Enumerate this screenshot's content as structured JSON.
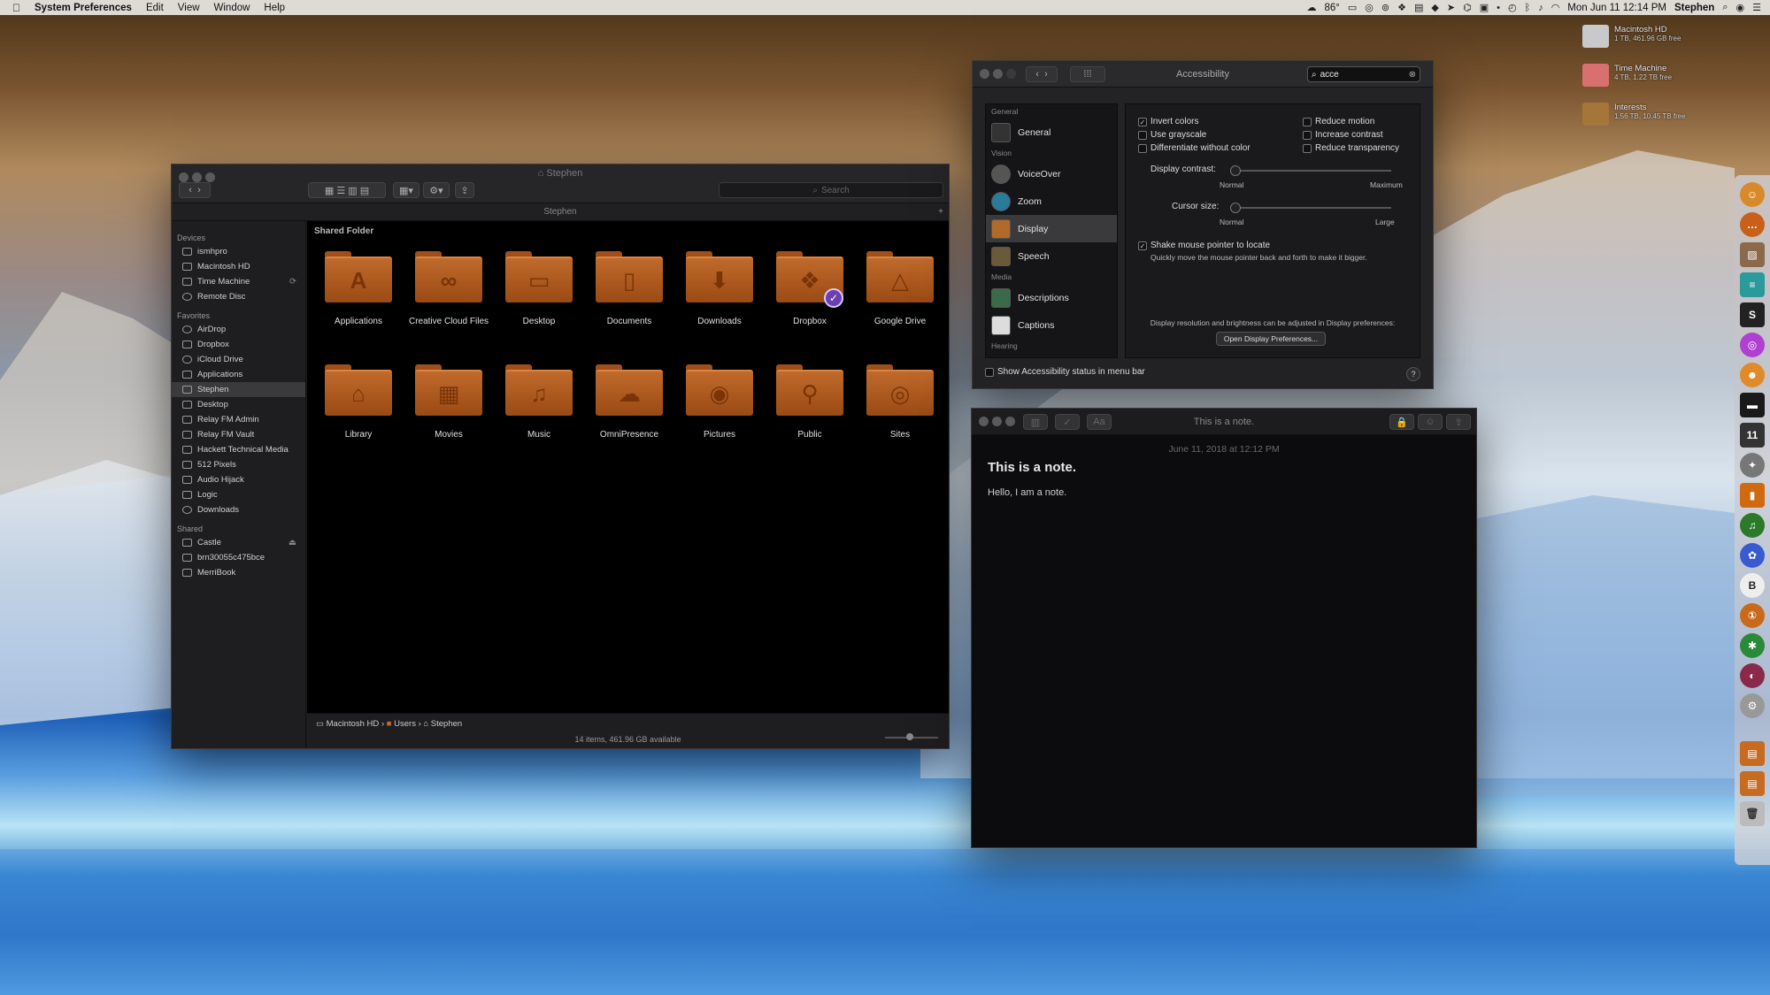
{
  "menubar": {
    "app": "System Preferences",
    "items": [
      "Edit",
      "View",
      "Window",
      "Help"
    ],
    "weather": "86°",
    "datetime": "Mon Jun 11  12:14 PM",
    "user": "Stephen"
  },
  "desktop": {
    "drives": [
      {
        "name": "Macintosh HD",
        "sub": "1 TB, 461.96 GB free"
      },
      {
        "name": "Time Machine",
        "sub": "4 TB, 1.22 TB free"
      },
      {
        "name": "Interests",
        "sub": "1.56 TB, 10.45 TB free"
      }
    ]
  },
  "finder": {
    "title": "Stephen",
    "path_title": "Stephen",
    "search_placeholder": "Search",
    "section": "Shared Folder",
    "sidebar": {
      "devices_h": "Devices",
      "devices": [
        "ismhpro",
        "Macintosh HD",
        "Time Machine",
        "Remote Disc"
      ],
      "favorites_h": "Favorites",
      "favorites": [
        "AirDrop",
        "Dropbox",
        "iCloud Drive",
        "Applications",
        "Stephen",
        "Desktop",
        "Relay FM Admin",
        "Relay FM Vault",
        "Hackett Technical Media",
        "512 Pixels",
        "Audio Hijack",
        "Logic",
        "Downloads"
      ],
      "shared_h": "Shared",
      "shared": [
        "Castle",
        "brn30055c475bce",
        "MerriBook"
      ]
    },
    "folders_row1": [
      {
        "label": "Applications",
        "glyph": "A"
      },
      {
        "label": "Creative Cloud Files",
        "glyph": "∞"
      },
      {
        "label": "Desktop",
        "glyph": "▭"
      },
      {
        "label": "Documents",
        "glyph": "▯"
      },
      {
        "label": "Downloads",
        "glyph": "⬇"
      },
      {
        "label": "Dropbox",
        "glyph": "❖"
      },
      {
        "label": "Google Drive",
        "glyph": "△"
      }
    ],
    "folders_row2": [
      {
        "label": "Library",
        "glyph": "⌂"
      },
      {
        "label": "Movies",
        "glyph": "▦"
      },
      {
        "label": "Music",
        "glyph": "♫"
      },
      {
        "label": "OmniPresence",
        "glyph": "☁"
      },
      {
        "label": "Pictures",
        "glyph": "◉"
      },
      {
        "label": "Public",
        "glyph": "⚲"
      },
      {
        "label": "Sites",
        "glyph": "◎"
      }
    ],
    "breadcrumb": [
      "Macintosh HD",
      "Users",
      "Stephen"
    ],
    "status": "14 items, 461.96 GB available"
  },
  "accessibility": {
    "title": "Accessibility",
    "search_value": "acce",
    "groups": {
      "general": "General",
      "vision": "Vision",
      "media": "Media",
      "hearing": "Hearing"
    },
    "items": {
      "general": "General",
      "voiceover": "VoiceOver",
      "zoom": "Zoom",
      "display": "Display",
      "speech": "Speech",
      "descriptions": "Descriptions",
      "captions": "Captions"
    },
    "options": {
      "invert": "Invert colors",
      "grayscale": "Use grayscale",
      "differentiate": "Differentiate without color",
      "motion": "Reduce motion",
      "contrast": "Increase contrast",
      "transparency": "Reduce transparency"
    },
    "display_contrast": "Display contrast:",
    "contrast_min": "Normal",
    "contrast_max": "Maximum",
    "cursor_size": "Cursor size:",
    "cursor_min": "Normal",
    "cursor_max": "Large",
    "shake": "Shake mouse pointer to locate",
    "shake_desc": "Quickly move the mouse pointer back and forth to make it bigger.",
    "resolution_note": "Display resolution and brightness can be adjusted in Display preferences:",
    "open_display": "Open Display Preferences...",
    "status_menu": "Show Accessibility status in menu bar",
    "help": "?"
  },
  "notes": {
    "title_bar": "This is a note.",
    "date": "June 11, 2018 at 12:12 PM",
    "heading": "This is a note.",
    "body": "Hello, I am a note."
  }
}
